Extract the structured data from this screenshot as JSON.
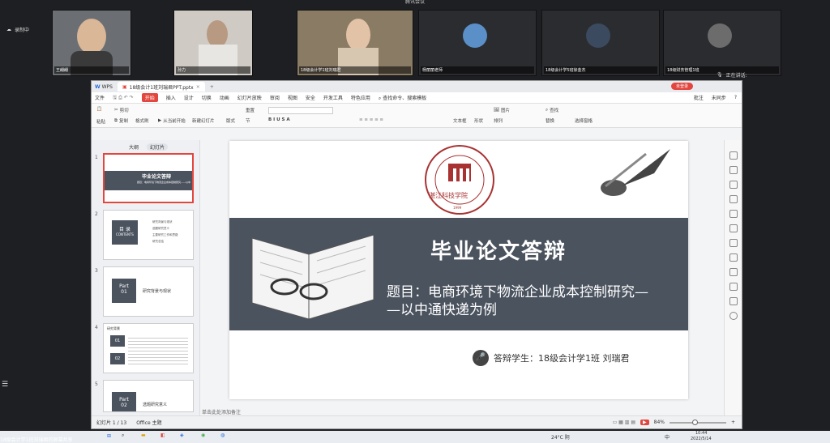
{
  "meeting": {
    "title": "腾讯会议",
    "recording": "录制中",
    "speaking": "正在讲话:",
    "participants": [
      {
        "name": "王翩翩"
      },
      {
        "name": "孙力"
      },
      {
        "name": "18级会计学1班刘瑞君"
      },
      {
        "name": "杨丽丽老师"
      },
      {
        "name": "18级会计学5班徐金杰"
      },
      {
        "name": "18级财务管理1班"
      }
    ]
  },
  "wps": {
    "app_tab": "WPS",
    "doc_tab": "18级会计1班刘瑞君PPT.pptx",
    "login": "未登录",
    "menu": [
      "文件",
      "开始",
      "插入",
      "设计",
      "切换",
      "动画",
      "幻灯片放映",
      "审阅",
      "视图",
      "安全",
      "开发工具",
      "特色应用"
    ],
    "search": "查找命令、搜索模板",
    "batch": "批注",
    "sync": "未同步",
    "ribbon": {
      "paste": "粘贴",
      "cut": "剪切",
      "copy": "复制",
      "format": "格式刷",
      "from_start": "从当前开始",
      "new_slide": "新建幻灯片",
      "layout": "版式",
      "section": "节",
      "reset": "重置",
      "textbox": "文本框",
      "shape": "形状",
      "arrange": "排列",
      "picture": "图片",
      "replace": "替换",
      "find": "查找",
      "select_pane": "选择窗格"
    },
    "panel": {
      "tab_outline": "大纲",
      "tab_slides": "幻灯片",
      "thumbs": [
        {
          "num": "1",
          "title": "毕业论文答辩",
          "sub": "题目：电商环境下物流企业成本控制研究——以中通快递为例"
        },
        {
          "num": "2",
          "title": "目 录",
          "sub": "CONTENTS",
          "items": [
            "研究背景与现状",
            "选题研究意义",
            "主要研究工作和思路",
            "研究总结"
          ]
        },
        {
          "num": "3",
          "part": "Part",
          "partnum": "01",
          "title": "研究背景与现状"
        },
        {
          "num": "4",
          "title": "研究背景",
          "n1": "01",
          "n2": "02"
        },
        {
          "num": "5",
          "part": "Part",
          "partnum": "02",
          "title": "选题研究意义"
        }
      ]
    },
    "slide": {
      "university": "ZHANJIANG UNIVERSITY OF SCIENCE AND TECHNOLOGY",
      "cn_name": "湛江科技学院",
      "year": "1999",
      "title": "毕业论文答辩",
      "subtitle1": "题目：电商环境下物流企业成本控制研究—",
      "subtitle2": "—以中通快递为例",
      "student": "答辩学生：18级会计学1班  刘瑞君"
    },
    "notes": "单击此处添加备注",
    "status": {
      "slide_index": "幻灯片 1 / 13",
      "theme": "Office 主题",
      "zoom": "84%"
    }
  },
  "taskbar": {
    "share": "18级会计学1班刘瑞君的屏幕共享",
    "weather": "24°C 阴",
    "ime": "中",
    "time": "10:44",
    "date": "2022/5/14"
  }
}
